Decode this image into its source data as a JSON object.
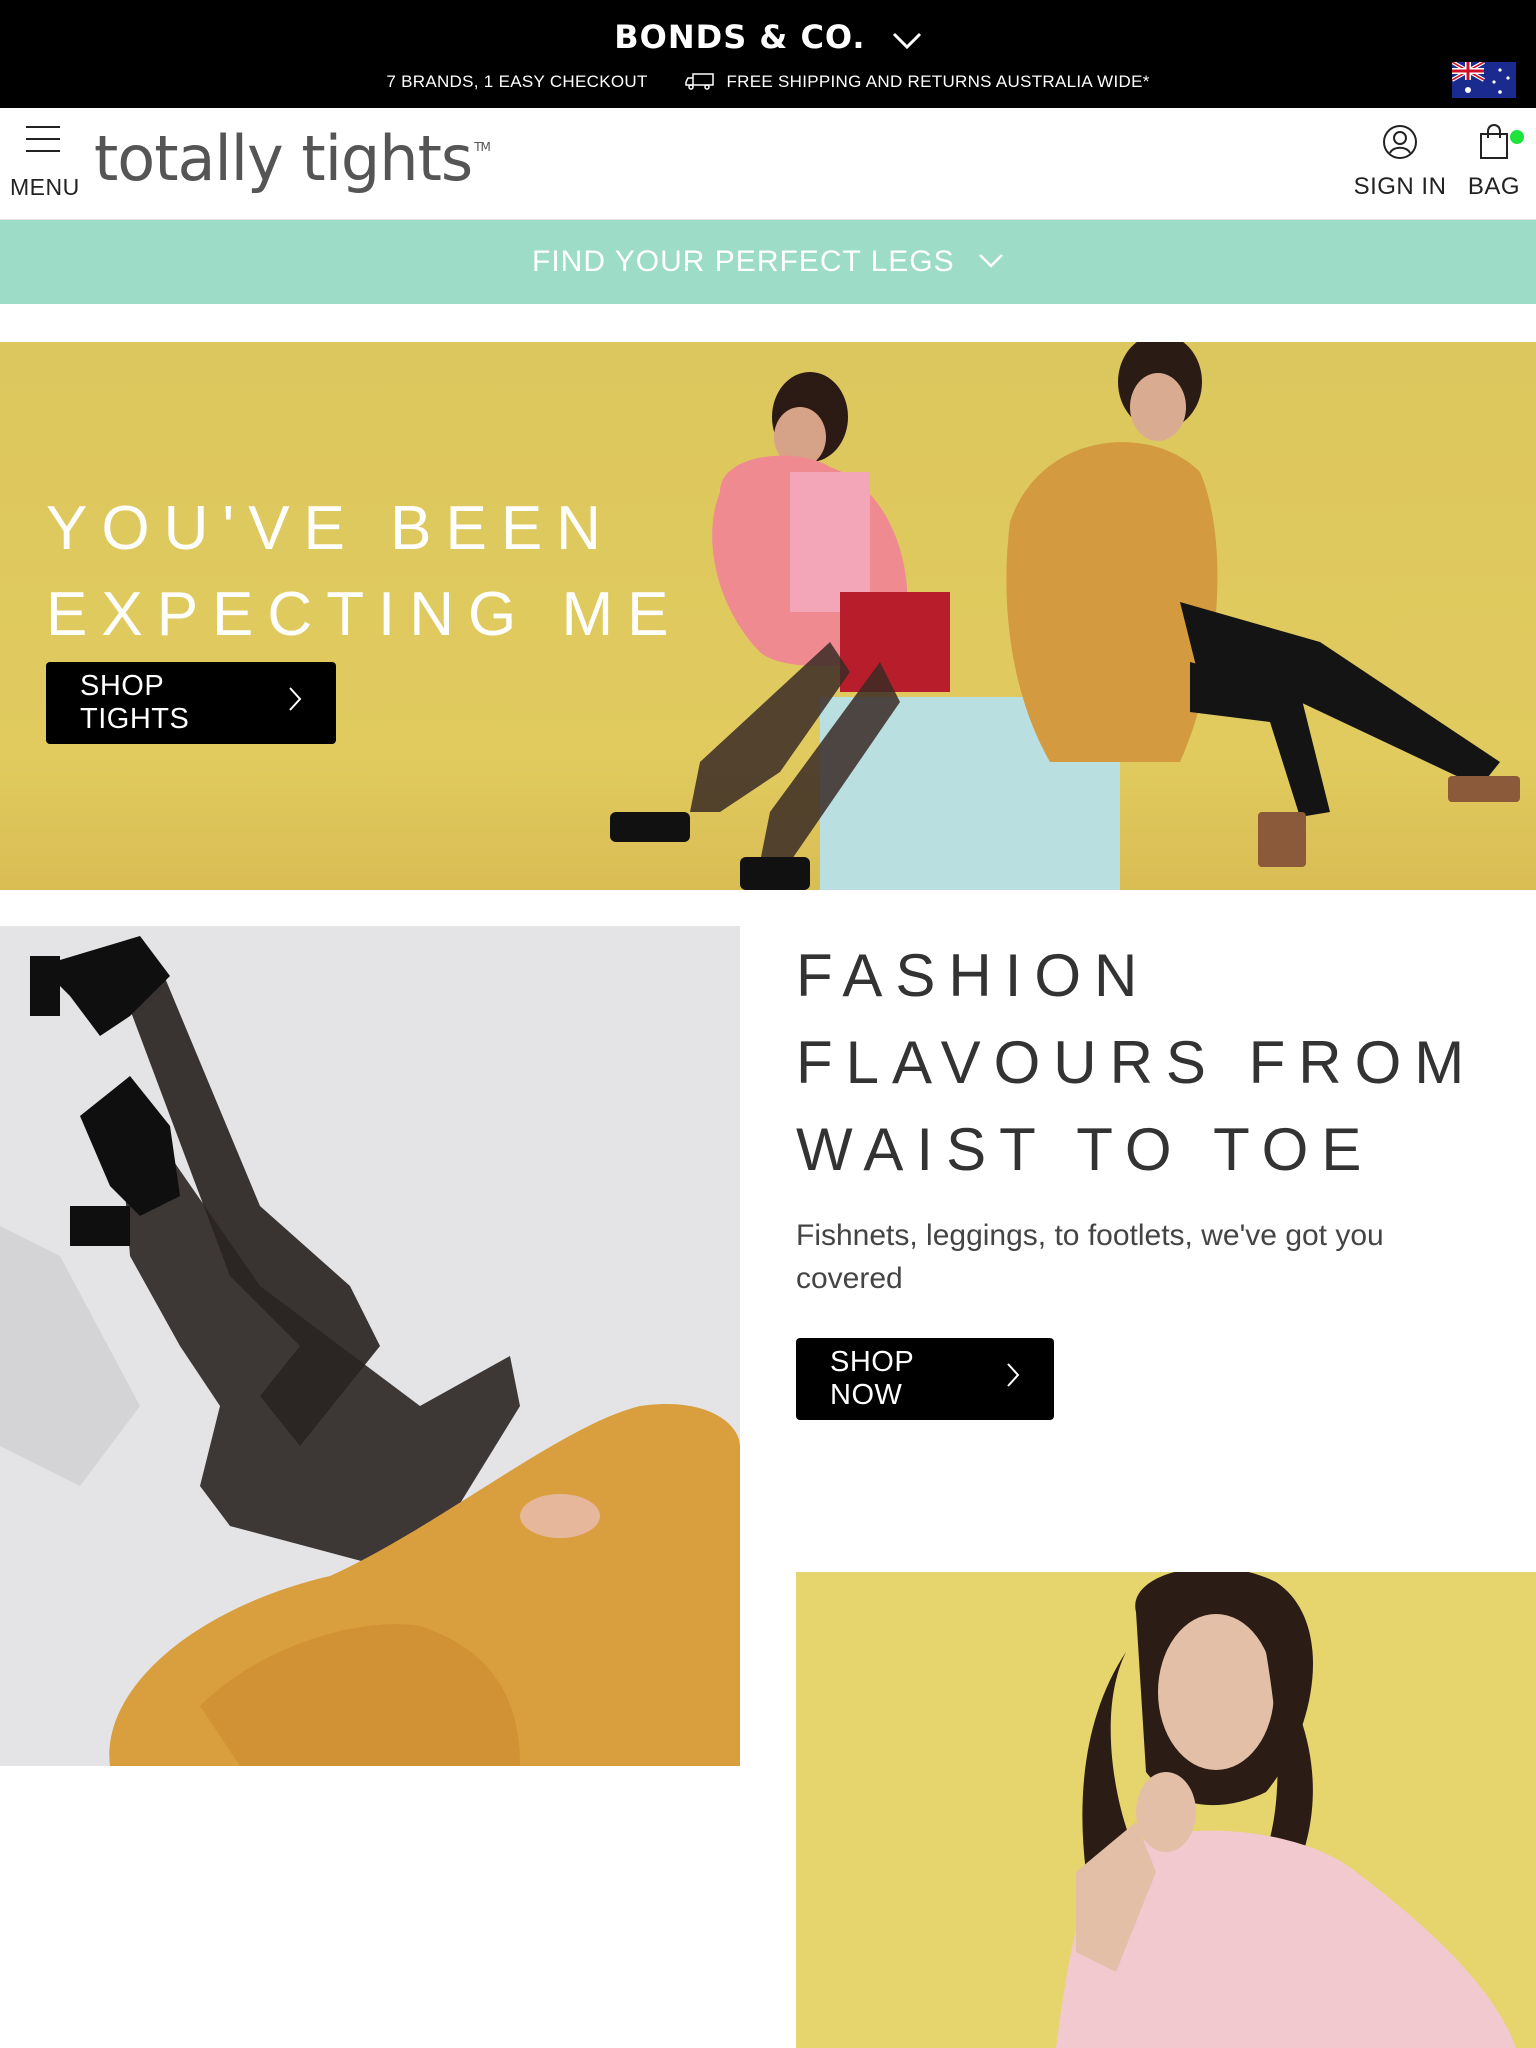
{
  "topbar": {
    "brand_switcher": "BONDS & CO.",
    "usp_left": "7 BRANDS, 1 EASY CHECKOUT",
    "usp_right": "FREE SHIPPING AND RETURNS AUSTRALIA WIDE*",
    "flag_icon": "australia-flag-icon"
  },
  "header": {
    "menu_label": "MENU",
    "logo": "totally tights",
    "logo_mark": "TM",
    "signin_label": "SIGN IN",
    "bag_label": "BAG"
  },
  "finder": {
    "label": "FIND YOUR PERFECT LEGS"
  },
  "hero": {
    "title_line1": "YOU'VE BEEN",
    "title_line2": "EXPECTING ME",
    "cta": "SHOP TIGHTS"
  },
  "feature": {
    "title_line1": "FASHION",
    "title_line2": "FLAVOURS FROM",
    "title_line3": "WAIST TO TOE",
    "text": "Fishnets, leggings, to footlets, we've got you covered",
    "cta": "SHOP NOW"
  },
  "colors": {
    "topbar": "#000000",
    "finder_bar": "#9ddcc6",
    "hero_bg": "#dbc55b",
    "bag_dot": "#1ee33a"
  }
}
